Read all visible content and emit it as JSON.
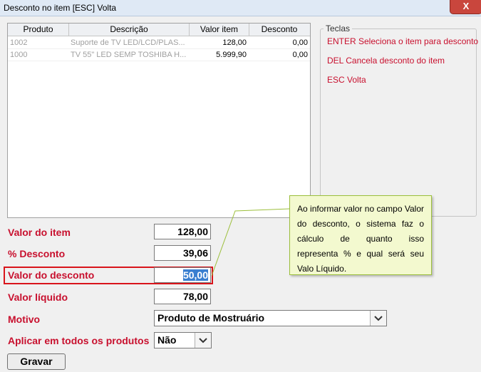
{
  "window": {
    "title": "Desconto no item [ESC] Volta",
    "close_label": "X"
  },
  "grid": {
    "columns": [
      "Produto",
      "Descrição",
      "Valor item",
      "Desconto"
    ],
    "rows": [
      [
        "1002",
        "Suporte de TV LED/LCD/PLAS...",
        "128,00",
        "0,00"
      ],
      [
        "1000",
        "TV 55\" LED SEMP TOSHIBA H...",
        "5.999,90",
        "0,00"
      ]
    ]
  },
  "teclas": {
    "title": "Teclas",
    "items": [
      "ENTER Seleciona o item para desconto",
      "DEL Cancela desconto do item",
      "ESC Volta"
    ]
  },
  "form": {
    "valor_item_label": "Valor do item",
    "valor_item": "128,00",
    "perc_desconto_label": "% Desconto",
    "perc_desconto": "39,06",
    "valor_desconto_label": "Valor do desconto",
    "valor_desconto": "50,00",
    "valor_liquido_label": "Valor líquido",
    "valor_liquido": "78,00",
    "motivo_label": "Motivo",
    "motivo_value": "Produto de Mostruário",
    "aplicar_label": "Aplicar em todos os produtos",
    "aplicar_value": "Não",
    "gravar_label": "Gravar"
  },
  "tooltip": {
    "text": "Ao informar valor no campo Valor do desconto, o sistema faz o cálculo de quanto isso representa % e qual será seu Valo Líquido."
  },
  "colors": {
    "label_red": "#c8102e",
    "highlight_red": "#d9141b",
    "tooltip_bg": "#f3f9cf"
  }
}
